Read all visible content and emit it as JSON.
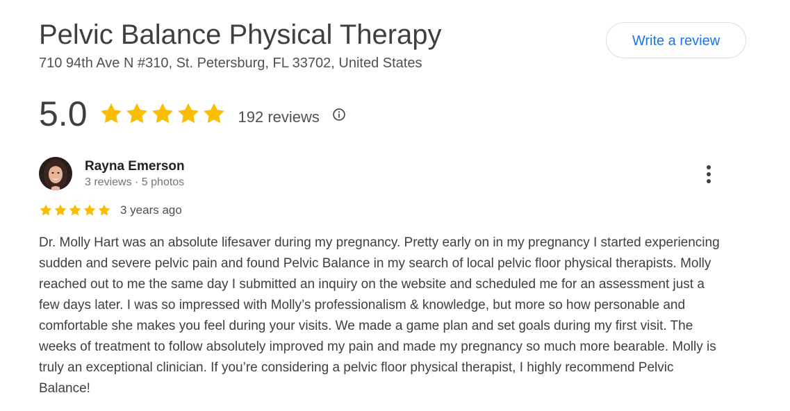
{
  "business": {
    "name": "Pelvic Balance Physical Therapy",
    "address": "710 94th Ave N #310, St. Petersburg, FL 33702, United States",
    "write_review_label": "Write a review"
  },
  "rating": {
    "score": "5.0",
    "stars": 5,
    "review_count_label": "192 reviews",
    "info_icon": "info-icon"
  },
  "review": {
    "reviewer_name": "Rayna Emerson",
    "reviewer_meta": "3 reviews · 5 photos",
    "stars": 5,
    "date": "3 years ago",
    "text": "Dr. Molly Hart was an absolute lifesaver during my pregnancy. Pretty early on in my pregnancy I started experiencing sudden and severe pelvic pain and found Pelvic Balance in my search of local pelvic floor physical therapists. Molly reached out to me the same day I submitted an inquiry on the website and scheduled me for an assessment just a few days later. I was so impressed with Molly’s professionalism & knowledge, but more so how personable and comfortable she makes you feel during your visits. We made a game plan and set goals during my first visit. The weeks of treatment to follow absolutely improved my pain and made my pregnancy so much more bearable. Molly is truly an exceptional clinician. If you’re considering a pelvic floor physical therapist, I highly recommend Pelvic Balance!",
    "more_icon": "more-vertical-icon"
  },
  "colors": {
    "star": "#fbbc04",
    "accent": "#1a73e8",
    "text_primary": "#202124",
    "text_secondary": "#70757a"
  }
}
